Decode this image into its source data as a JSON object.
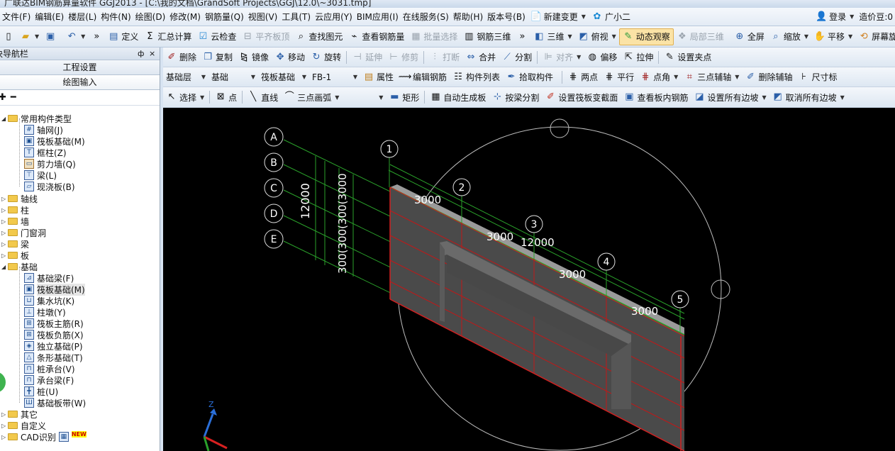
{
  "window": {
    "title": "广联达BIM钢筋算量软件 GGJ2013 - [C:\\我的文档\\GrandSoft Projects\\GGJ\\12.0\\~3031.tmp]"
  },
  "menu": [
    "文件(F)",
    "编辑(E)",
    "楼层(L)",
    "构件(N)",
    "绘图(D)",
    "修改(M)",
    "钢筋量(Q)",
    "视图(V)",
    "工具(T)",
    "云应用(Y)",
    "BIM应用(I)",
    "在线服务(S)",
    "帮助(H)",
    "版本号(B)",
    "新建变更",
    "广小二",
    "登录",
    "造价豆:0"
  ],
  "toolbar1": [
    "定义",
    "汇总计算",
    "云检查",
    "平齐板顶",
    "查找图元",
    "查看钢筋量",
    "批量选择",
    "钢筋三维",
    "三维",
    "俯视",
    "动态观察",
    "局部三维",
    "全屏",
    "缩放",
    "平移",
    "屏幕旋"
  ],
  "toolbar2": [
    "删除",
    "复制",
    "镜像",
    "移动",
    "旋转",
    "延伸",
    "修剪",
    "打断",
    "合并",
    "分割",
    "对齐",
    "偏移",
    "拉伸",
    "设置夹点"
  ],
  "toolbar3": {
    "floor": "基础层",
    "category": "基础",
    "type": "筏板基础",
    "name": "FB-1",
    "buttons": [
      "属性",
      "编辑钢筋",
      "构件列表",
      "拾取构件",
      "两点",
      "平行",
      "点角",
      "三点辅轴",
      "删除辅轴",
      "尺寸标"
    ]
  },
  "toolbar4": [
    "选择",
    "点",
    "直线",
    "三点画弧",
    "矩形",
    "自动生成板",
    "按梁分割",
    "设置筏板变截面",
    "查看板内钢筋",
    "设置所有边坡",
    "取消所有边坡"
  ],
  "panel": {
    "title": "模块导航栏",
    "pin": "ф",
    "close": "×",
    "btn_project": "工程设置",
    "btn_draw": "绘图输入"
  },
  "tree": {
    "common": {
      "label": "常用构件类型",
      "items": [
        "轴网(J)",
        "筏板基础(M)",
        "框柱(Z)",
        "剪力墙(Q)",
        "梁(L)",
        "现浇板(B)"
      ]
    },
    "groups1": [
      "轴线",
      "柱",
      "墙",
      "门窗洞",
      "梁",
      "板"
    ],
    "foundation": {
      "label": "基础",
      "items": [
        "基础梁(F)",
        "筏板基础(M)",
        "集水坑(K)",
        "柱墩(Y)",
        "筏板主筋(R)",
        "筏板负筋(X)",
        "独立基础(P)",
        "条形基础(T)",
        "桩承台(V)",
        "承台梁(F)",
        "桩(U)",
        "基础板带(W)"
      ]
    },
    "groups2": [
      "其它",
      "自定义",
      "CAD识别"
    ],
    "new_badge": "NEW"
  },
  "viewport": {
    "row_axes": [
      "A",
      "B",
      "C",
      "D",
      "E"
    ],
    "col_axes": [
      "1",
      "2",
      "3",
      "4",
      "5"
    ],
    "dim_total_row": "12000",
    "dim_row_parts": "300(300(300(3000",
    "dim_col_total": "12000",
    "dim_col_part": "3000",
    "axis_z": "Z"
  }
}
